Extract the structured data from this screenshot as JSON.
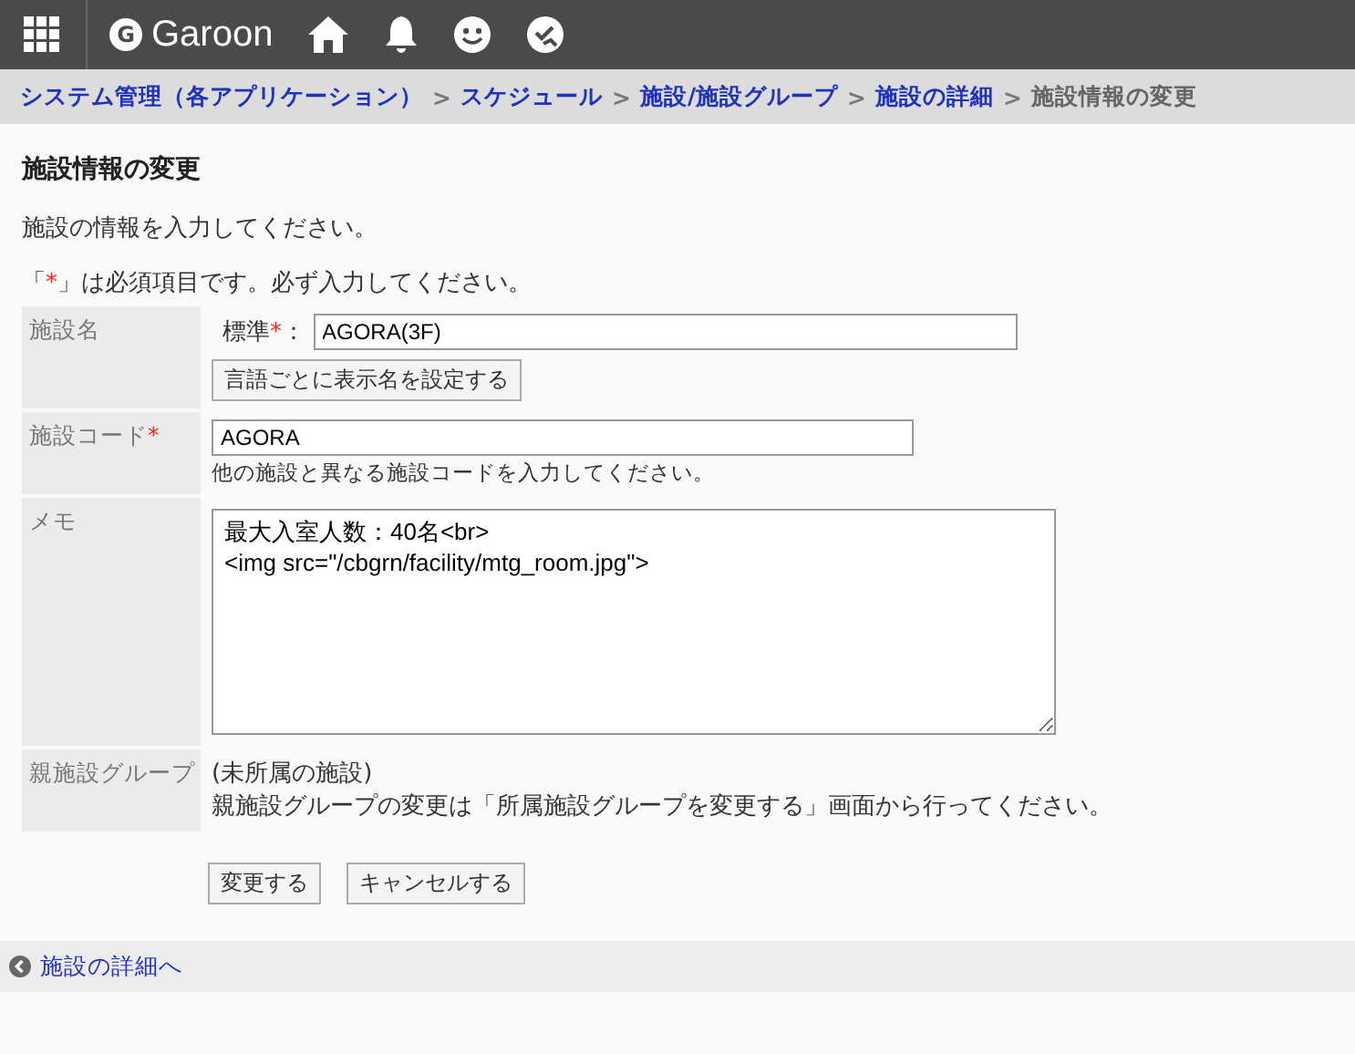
{
  "header": {
    "logo_letter": "G",
    "logo": "Garoon"
  },
  "breadcrumb": [
    {
      "label": "システム管理（各アプリケーション）",
      "link": true
    },
    {
      "label": "スケジュール",
      "link": true,
      "separator": ">"
    },
    {
      "label": "施設/施設グループ",
      "link": true,
      "separator": ">"
    },
    {
      "label": "施設の詳細",
      "link": true,
      "separator": ">"
    },
    {
      "label": "施設情報の変更",
      "link": false,
      "separator": ">"
    }
  ],
  "title": "施設情報の変更",
  "intro": "施設の情報を入力してください。",
  "required_note": {
    "open": "「",
    "mark": "*",
    "rest": "」は必須項目です。必ず入力してください。"
  },
  "rows": [
    {
      "kind": "name",
      "label": "施設名",
      "sub_label": "標準",
      "required_mark": "*",
      "colon": "：",
      "value": "AGORA(3F)",
      "button": "言語ごとに表示名を設定する"
    },
    {
      "kind": "code",
      "label": "施設コード",
      "required_mark": "*",
      "value": "AGORA",
      "hint": "他の施設と異なる施設コードを入力してください。"
    },
    {
      "kind": "memo",
      "label": "メモ",
      "value": "最大入室人数：40名<br>\n<img src=\"/cbgrn/facility/mtg_room.jpg\">"
    },
    {
      "kind": "parent",
      "label": "親施設グループ",
      "value": "(未所属の施設)",
      "note": "親施設グループの変更は「所属施設グループを変更する」画面から行ってください。"
    }
  ],
  "buttons": [
    "変更する",
    "キャンセルする"
  ],
  "footer_link": "施設の詳細へ"
}
